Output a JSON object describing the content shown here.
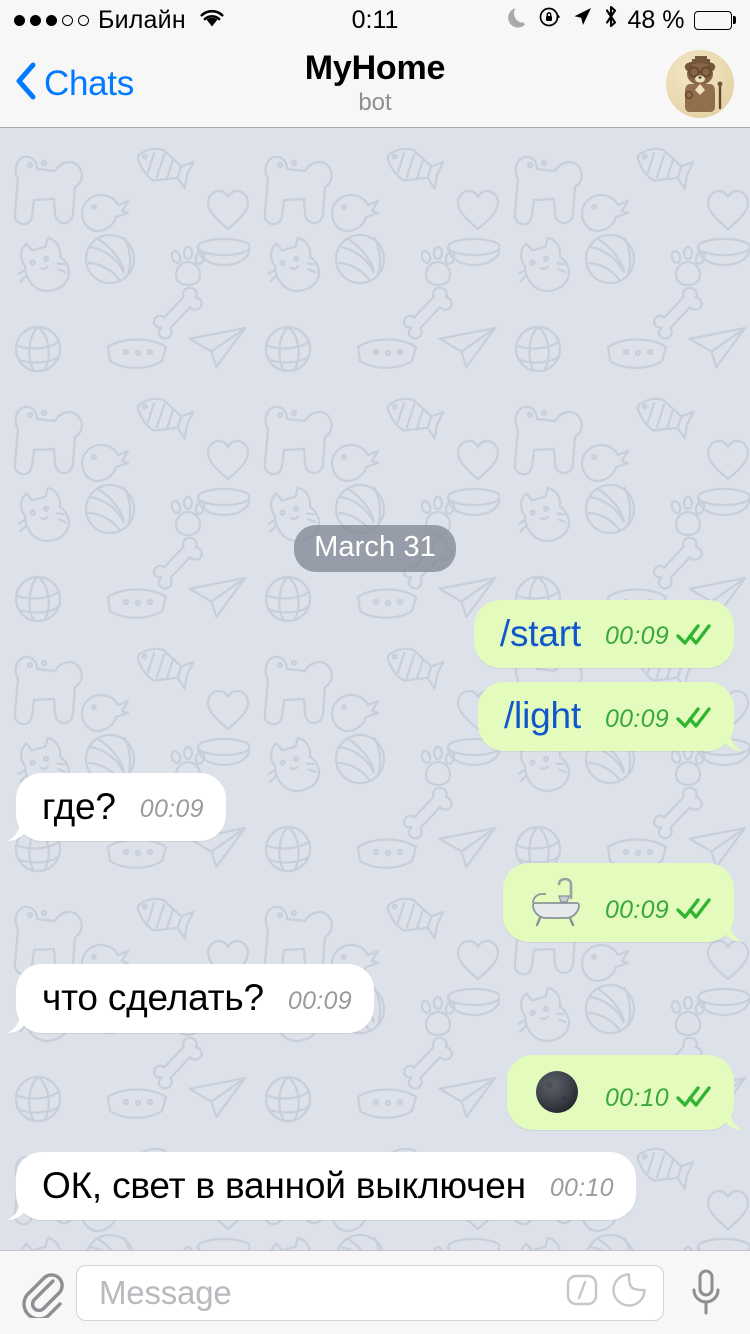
{
  "status_bar": {
    "signal_dots_total": 5,
    "signal_dots_filled": 3,
    "carrier": "Билайн",
    "wifi_icon": "wifi-icon",
    "time": "0:11",
    "dnd_icon": "moon-icon",
    "rotation_lock_icon": "rotation-lock-icon",
    "location_icon": "location-arrow-icon",
    "bluetooth_icon": "bluetooth-icon",
    "battery_percent": "48 %",
    "battery_level": 48
  },
  "nav_bar": {
    "back_icon": "chevron-left-icon",
    "back_label": "Chats",
    "title": "MyHome",
    "subtitle": "bot",
    "avatar_alt": "steampunk-panda-avatar"
  },
  "chat": {
    "date_separator": "March 31",
    "messages": [
      {
        "id": "m1",
        "direction": "out",
        "kind": "command",
        "text": "/start",
        "time": "00:09",
        "status": "read",
        "tail": false
      },
      {
        "id": "m2",
        "direction": "out",
        "kind": "command",
        "text": "/light",
        "time": "00:09",
        "status": "read",
        "tail": true
      },
      {
        "id": "m3",
        "direction": "in",
        "kind": "text",
        "text": "где?",
        "time": "00:09",
        "status": "",
        "tail": true
      },
      {
        "id": "m4",
        "direction": "out",
        "kind": "emoji",
        "text": "bathtub",
        "time": "00:09",
        "status": "read",
        "tail": true
      },
      {
        "id": "m5",
        "direction": "in",
        "kind": "text",
        "text": "что сделать?",
        "time": "00:09",
        "status": "",
        "tail": true
      },
      {
        "id": "m6",
        "direction": "out",
        "kind": "emoji",
        "text": "new-moon",
        "time": "00:10",
        "status": "read",
        "tail": true
      },
      {
        "id": "m7",
        "direction": "in",
        "kind": "text",
        "text": "ОК, свет в ванной выключен",
        "time": "00:10",
        "status": "",
        "tail": true
      }
    ],
    "read_receipt_icon": "double-check-icon",
    "wallpaper": "pets-doodle-pattern"
  },
  "input_bar": {
    "attach_icon": "paperclip-icon",
    "placeholder": "Message",
    "command_icon": "slash-command-icon",
    "sticker_icon": "sticker-icon",
    "mic_icon": "microphone-icon"
  },
  "colors": {
    "outgoing_bubble": "#e3fcbe",
    "incoming_bubble": "#ffffff",
    "chat_background": "#dde1e9",
    "accent_blue": "#007aff",
    "command_text": "#1256cc",
    "read_check_green": "#3aa83a",
    "bar_background": "#f7f7f7"
  }
}
